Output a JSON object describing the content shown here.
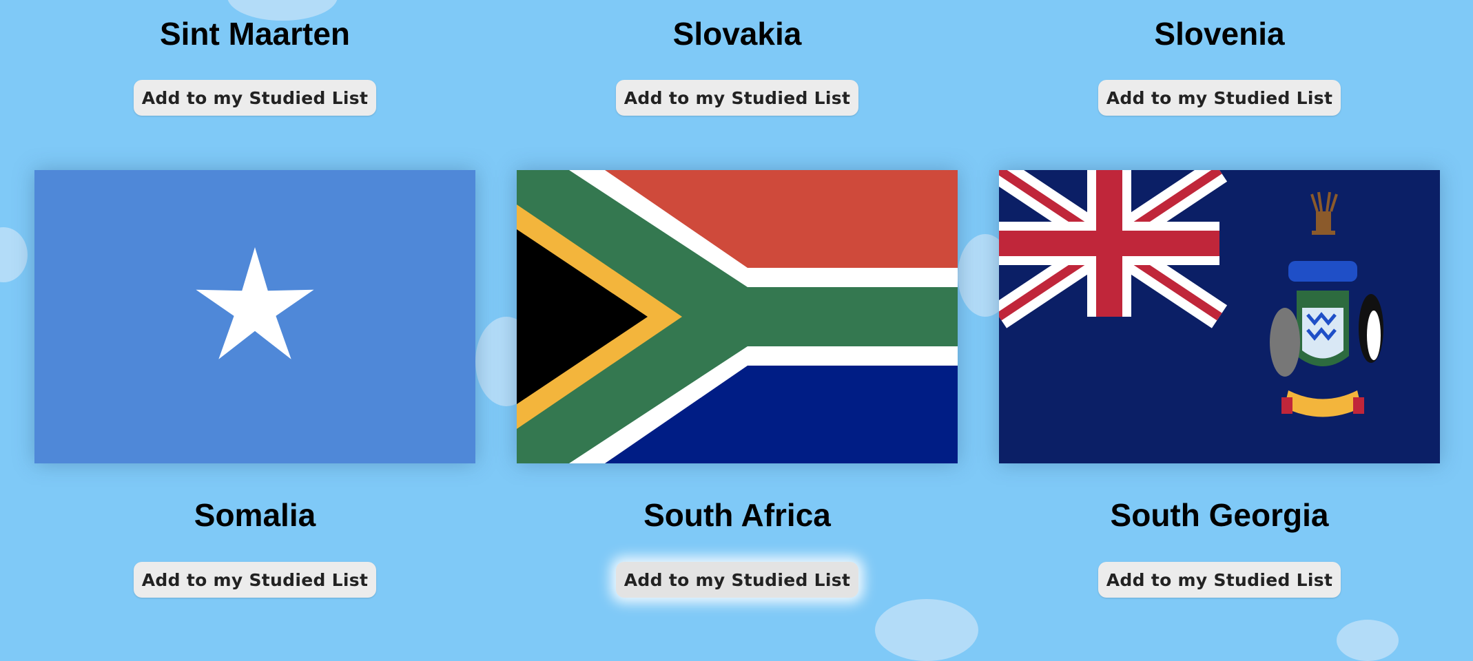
{
  "colors": {
    "background": "#7fc9f7",
    "button_bg": "#ececec",
    "somalia_blue": "#4f88d8",
    "sa_red": "#cf4a3b",
    "sa_green": "#347850",
    "sa_blue": "#001d85",
    "sa_gold": "#f3b53c",
    "sg_navy": "#0b1f66",
    "sg_red": "#c0263a"
  },
  "top_row": [
    {
      "name": "Sint Maarten",
      "button_label": "Add to my Studied List"
    },
    {
      "name": "Slovakia",
      "button_label": "Add to my Studied List"
    },
    {
      "name": "Slovenia",
      "button_label": "Add to my Studied List"
    }
  ],
  "bottom_row": [
    {
      "name": "Somalia",
      "button_label": "Add to my Studied List",
      "flag_icon": "somalia-flag"
    },
    {
      "name": "South Africa",
      "button_label": "Add to my Studied List",
      "flag_icon": "south-africa-flag"
    },
    {
      "name": "South Georgia",
      "button_label": "Add to my Studied List",
      "flag_icon": "south-georgia-flag"
    }
  ]
}
